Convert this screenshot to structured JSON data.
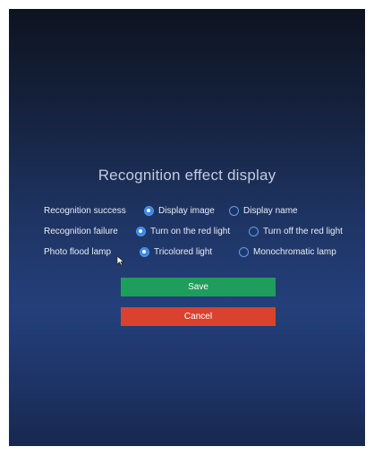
{
  "dialog": {
    "title": "Recognition effect display"
  },
  "settings": [
    {
      "label": "Recognition success",
      "options": [
        {
          "label": "Display image",
          "selected": true
        },
        {
          "label": "Display name",
          "selected": false
        }
      ]
    },
    {
      "label": "Recognition failure",
      "options": [
        {
          "label": "Turn on the red light",
          "selected": true
        },
        {
          "label": "Turn off the red light",
          "selected": false
        }
      ]
    },
    {
      "label": "Photo flood lamp",
      "options": [
        {
          "label": "Tricolored light",
          "selected": true
        },
        {
          "label": "Monochromatic lamp",
          "selected": false
        }
      ]
    }
  ],
  "buttons": {
    "save_label": "Save",
    "cancel_label": "Cancel"
  },
  "colors": {
    "save": "#1f9d5c",
    "cancel": "#d9432d",
    "radio_accent": "#3b87e6"
  }
}
